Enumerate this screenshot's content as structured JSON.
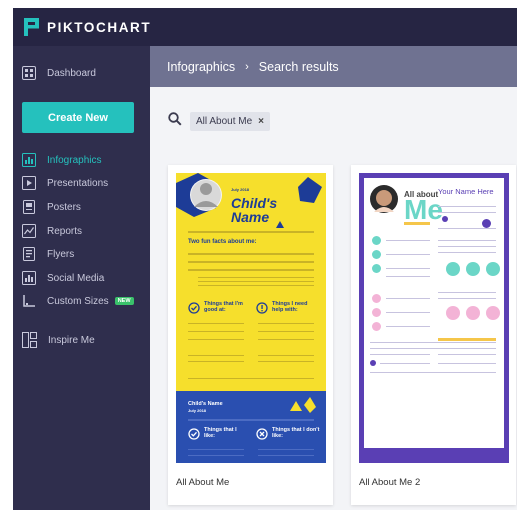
{
  "app": {
    "brand": "PIKTOCHART"
  },
  "sidebar": {
    "items": [
      {
        "label": "Dashboard",
        "icon": "dashboard-icon"
      },
      {
        "label": "Create New"
      },
      {
        "label": "Infographics",
        "icon": "infographics-icon",
        "active": true
      },
      {
        "label": "Presentations",
        "icon": "presentations-icon"
      },
      {
        "label": "Posters",
        "icon": "posters-icon"
      },
      {
        "label": "Reports",
        "icon": "reports-icon"
      },
      {
        "label": "Flyers",
        "icon": "flyers-icon"
      },
      {
        "label": "Social Media",
        "icon": "social-media-icon"
      },
      {
        "label": "Custom Sizes",
        "icon": "custom-sizes-icon",
        "badge": "NEW"
      },
      {
        "label": "Inspire Me",
        "icon": "inspire-me-icon"
      }
    ]
  },
  "breadcrumb": {
    "root": "Infographics",
    "separator": "›",
    "current": "Search results"
  },
  "search": {
    "chip": "All About Me",
    "remove": "×"
  },
  "templates": [
    {
      "caption": "All About Me",
      "thumb": {
        "date": "July 2018",
        "title_line1": "Child's",
        "title_line2": "Name",
        "subtitle": "Two fun facts about me:",
        "box1": "Things that I'm good at:",
        "box2": "Things I need help with:",
        "bottom_title": "Child's Name",
        "bottom_date": "July 2018",
        "box3": "Things that I like:",
        "box4": "Things that I don't like:"
      }
    },
    {
      "caption": "All About Me 2",
      "thumb": {
        "all_about": "All about",
        "me": "Me",
        "your_name": "Your Name Here"
      }
    }
  ],
  "colors": {
    "accent": "#25c1bd",
    "topbar": "#262543",
    "sidebar": "#2f2e4d",
    "crumbbar": "#6f7291",
    "badge": "#3ac26b"
  }
}
